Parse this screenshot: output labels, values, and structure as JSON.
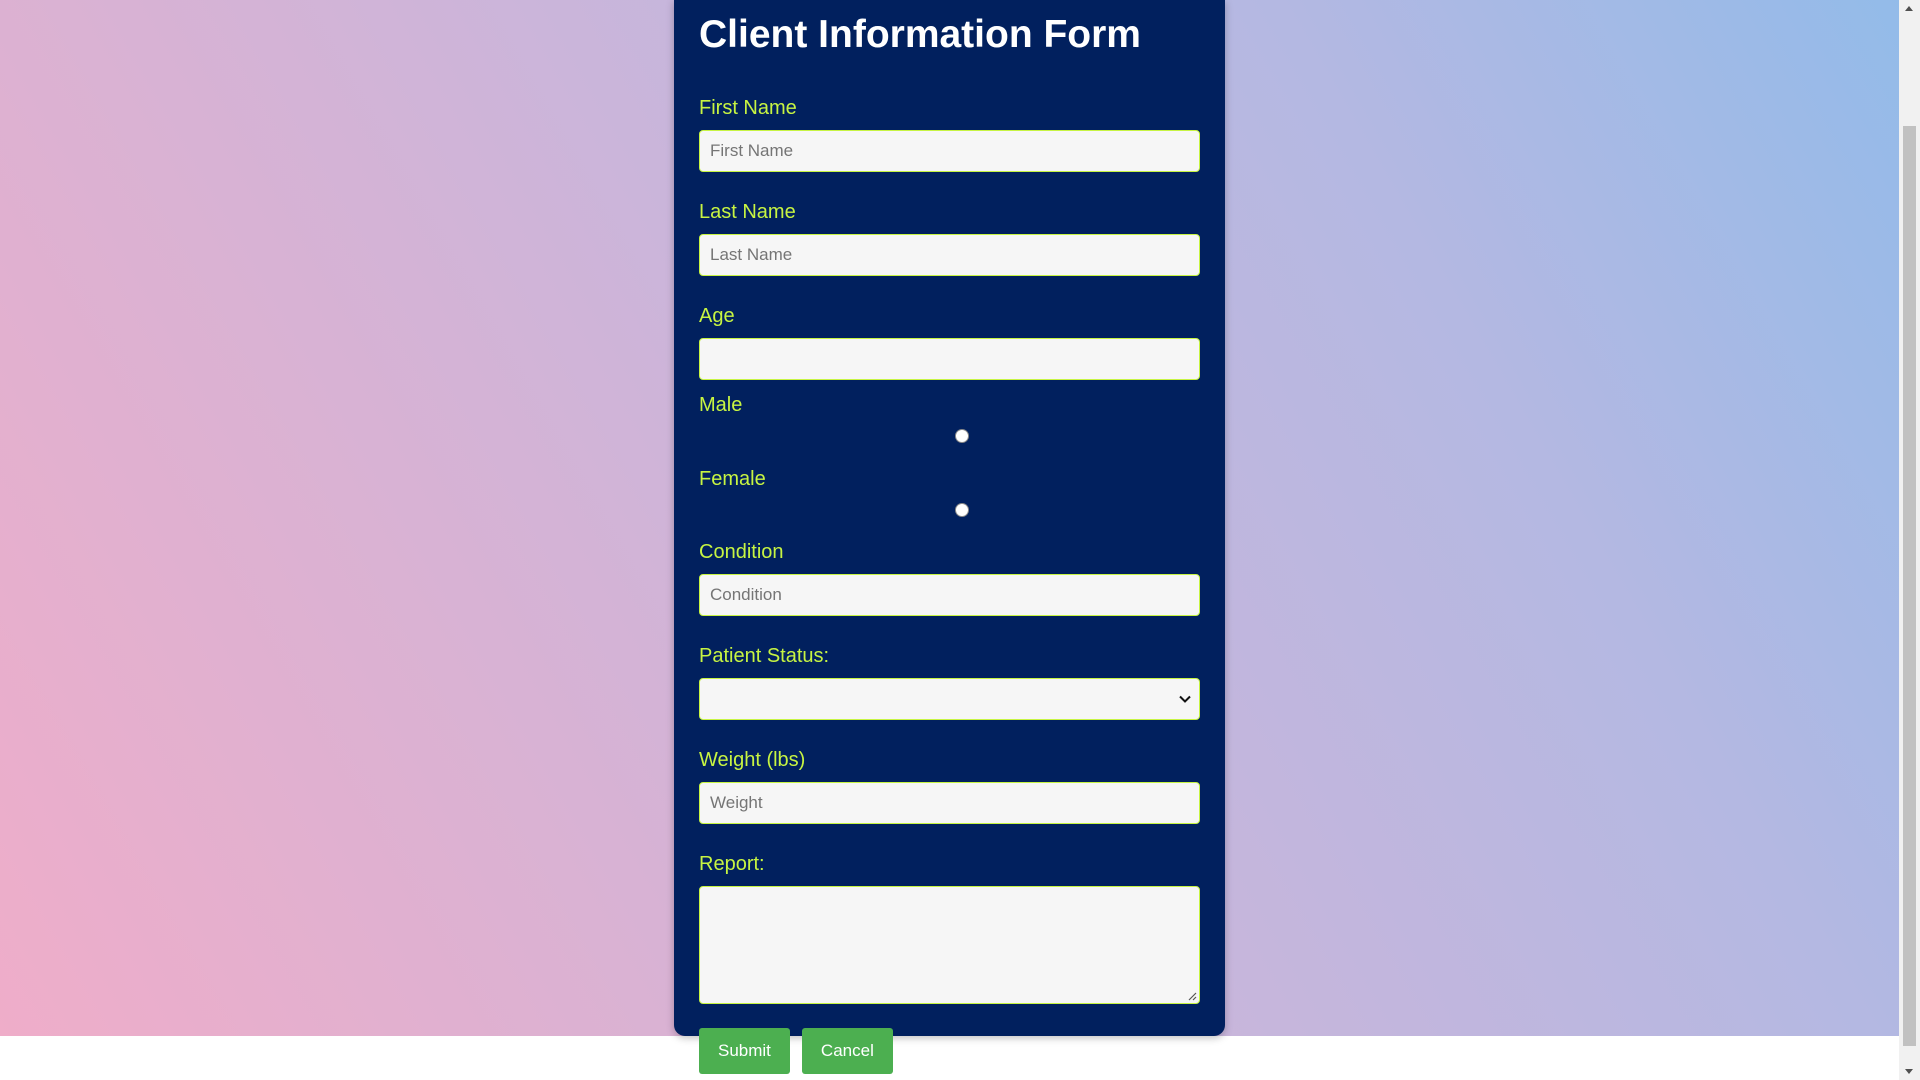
{
  "form": {
    "title": "Client Information Form",
    "first_name": {
      "label": "First Name",
      "placeholder": "First Name",
      "value": ""
    },
    "last_name": {
      "label": "Last Name",
      "placeholder": "Last Name",
      "value": ""
    },
    "age": {
      "label": "Age",
      "placeholder": "",
      "value": ""
    },
    "gender": {
      "male_label": "Male",
      "female_label": "Female",
      "male_checked": false,
      "female_checked": false
    },
    "condition": {
      "label": "Condition",
      "placeholder": "Condition",
      "value": ""
    },
    "patient_status": {
      "label": "Patient Status:",
      "selected": ""
    },
    "weight": {
      "label": "Weight (lbs)",
      "placeholder": "Weight",
      "value": ""
    },
    "report": {
      "label": "Report:",
      "value": ""
    },
    "submit_label": "Submit",
    "cancel_label": "Cancel"
  },
  "colors": {
    "card_background": "#01205e",
    "label_color": "#c7f442",
    "title_color": "#ffffff",
    "button_color": "#4caf50",
    "gradient_stops": [
      "#efadc9",
      "#cbb5da",
      "#b4b8e2",
      "#93bbe9"
    ]
  }
}
